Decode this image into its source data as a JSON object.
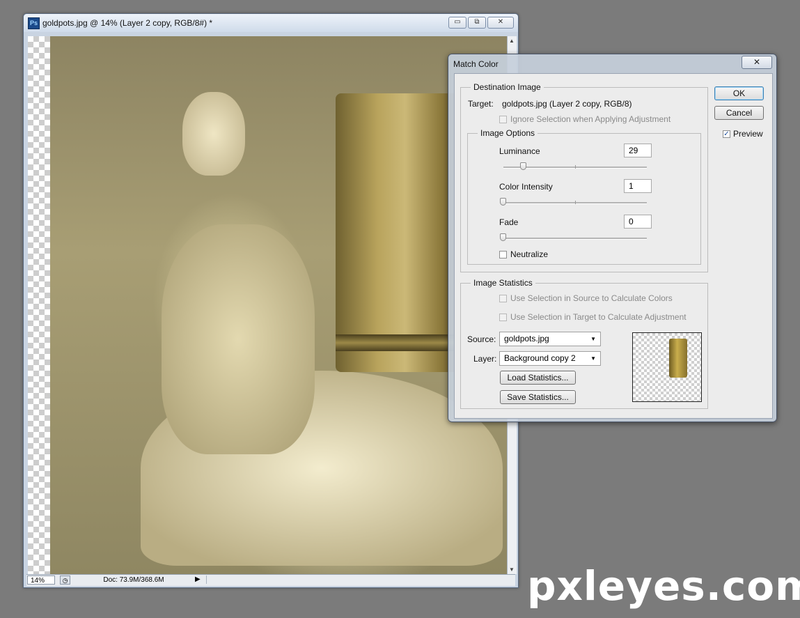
{
  "document": {
    "title": "goldpots.jpg @ 14% (Layer 2 copy, RGB/8#) *",
    "app_icon": "Ps",
    "zoom": "14%",
    "doc_info": "Doc: 73.9M/368.6M",
    "window_buttons": {
      "minimize": "▭",
      "restore": "⧉",
      "close": "✕"
    }
  },
  "dialog": {
    "title": "Match Color",
    "close_label": "✕",
    "destination": {
      "legend": "Destination Image",
      "target_label": "Target:",
      "target_value": "goldpots.jpg (Layer 2 copy, RGB/8)",
      "ignore_selection": {
        "label": "Ignore Selection when Applying Adjustment",
        "checked": false,
        "enabled": false
      }
    },
    "image_options": {
      "legend": "Image Options",
      "luminance": {
        "label": "Luminance",
        "value": "29",
        "min": 1,
        "max": 200
      },
      "color_intensity": {
        "label": "Color Intensity",
        "value": "1",
        "min": 1,
        "max": 200
      },
      "fade": {
        "label": "Fade",
        "value": "0",
        "min": 0,
        "max": 100
      },
      "neutralize": {
        "label": "Neutralize",
        "checked": false
      }
    },
    "image_statistics": {
      "legend": "Image Statistics",
      "use_sel_source": {
        "label": "Use Selection in Source to Calculate Colors",
        "checked": false,
        "enabled": false
      },
      "use_sel_target": {
        "label": "Use Selection in Target to Calculate Adjustment",
        "checked": false,
        "enabled": false
      },
      "source_label": "Source:",
      "source_value": "goldpots.jpg",
      "layer_label": "Layer:",
      "layer_value": "Background copy 2",
      "load_label": "Load Statistics...",
      "save_label": "Save Statistics..."
    },
    "ok_label": "OK",
    "cancel_label": "Cancel",
    "preview": {
      "label": "Preview",
      "checked": true
    }
  },
  "watermark": "pxleyes.com"
}
